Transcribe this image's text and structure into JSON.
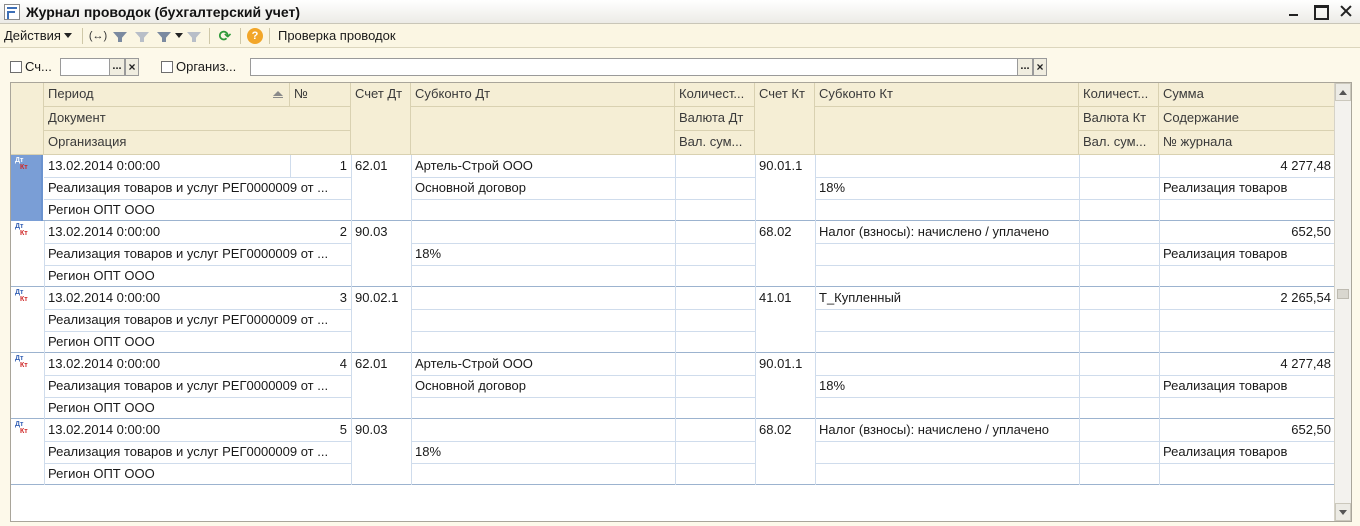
{
  "window": {
    "title": "Журнал проводок (бухгалтерский учет)"
  },
  "toolbar": {
    "actions_label": "Действия",
    "check_label": "Проверка проводок",
    "help_glyph": "?",
    "refresh_glyph": "⟳",
    "arrows_glyph": "(↔)"
  },
  "filters": {
    "account_label": "Сч...",
    "org_label": "Организ...",
    "pick_glyph": "...",
    "clear_glyph": "×"
  },
  "columns": {
    "period": "Период",
    "number": "№",
    "document": "Документ",
    "organization": "Организация",
    "debit_account": "Счет Дт",
    "debit_subconto": "Субконто Дт",
    "debit_qty": "Количест...",
    "debit_currency": "Валюта Дт",
    "debit_cur_sum": "Вал. сум...",
    "credit_account": "Счет Кт",
    "credit_subconto": "Субконто Кт",
    "credit_qty": "Количест...",
    "credit_currency": "Валюта Кт",
    "credit_cur_sum": "Вал. сум...",
    "sum": "Сумма",
    "content": "Содержание",
    "journal_no": "№ журнала"
  },
  "row_icon": {
    "dt": "Дт",
    "kt": "Кт"
  },
  "rows": [
    {
      "period": "13.02.2014 0:00:00",
      "number": "1",
      "document": "Реализация товаров и услуг РЕГ0000009 от ...",
      "organization": "Регион ОПТ ООО",
      "debit_account": "62.01",
      "debit_subconto1": "Артель-Строй ООО",
      "debit_subconto2": "Основной договор",
      "credit_account": "90.01.1",
      "credit_subconto1": "",
      "credit_subconto2": "18%",
      "sum": "4 277,48",
      "content": "Реализация товаров"
    },
    {
      "period": "13.02.2014 0:00:00",
      "number": "2",
      "document": "Реализация товаров и услуг РЕГ0000009 от ...",
      "organization": "Регион ОПТ ООО",
      "debit_account": "90.03",
      "debit_subconto1": "",
      "debit_subconto2": "18%",
      "credit_account": "68.02",
      "credit_subconto1": "Налог (взносы): начислено / уплачено",
      "credit_subconto2": "",
      "sum": "652,50",
      "content": "Реализация товаров"
    },
    {
      "period": "13.02.2014 0:00:00",
      "number": "3",
      "document": "Реализация товаров и услуг РЕГ0000009 от ...",
      "organization": "Регион ОПТ ООО",
      "debit_account": "90.02.1",
      "debit_subconto1": "",
      "debit_subconto2": "",
      "credit_account": "41.01",
      "credit_subconto1": "Т_Купленный",
      "credit_subconto2": "",
      "sum": "2 265,54",
      "content": ""
    },
    {
      "period": "13.02.2014 0:00:00",
      "number": "4",
      "document": "Реализация товаров и услуг РЕГ0000009 от ...",
      "organization": "Регион ОПТ ООО",
      "debit_account": "62.01",
      "debit_subconto1": "Артель-Строй ООО",
      "debit_subconto2": "Основной договор",
      "credit_account": "90.01.1",
      "credit_subconto1": "",
      "credit_subconto2": "18%",
      "sum": "4 277,48",
      "content": "Реализация товаров"
    },
    {
      "period": "13.02.2014 0:00:00",
      "number": "5",
      "document": "Реализация товаров и услуг РЕГ0000009 от ...",
      "organization": "Регион ОПТ ООО",
      "debit_account": "90.03",
      "debit_subconto1": "",
      "debit_subconto2": "18%",
      "credit_account": "68.02",
      "credit_subconto1": "Налог (взносы): начислено / уплачено",
      "credit_subconto2": "",
      "sum": "652,50",
      "content": "Реализация товаров"
    }
  ]
}
